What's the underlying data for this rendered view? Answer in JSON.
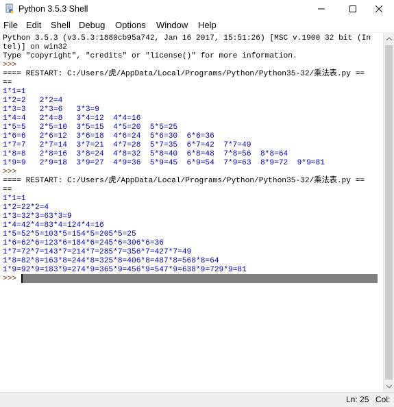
{
  "window": {
    "title": "Python 3.5.3 Shell"
  },
  "menu": {
    "items": [
      "File",
      "Edit",
      "Shell",
      "Debug",
      "Options",
      "Window",
      "Help"
    ]
  },
  "shell": {
    "lines": [
      {
        "text": "Python 3.5.3 (v3.5.3:1880cb95a742, Jan 16 2017, 15:51:26) [MSC v.1900 32 bit (In",
        "style": "black"
      },
      {
        "text": "tel)] on win32",
        "style": "black"
      },
      {
        "text": "Type \"copyright\", \"credits\" or \"license()\" for more information.",
        "style": "black"
      },
      {
        "text": ">>> ",
        "style": "prompt"
      },
      {
        "text": "==== RESTART: C:/Users/虎/AppData/Local/Programs/Python/Python35-32/乘法表.py ==",
        "style": "black"
      },
      {
        "text": "==",
        "style": "black"
      },
      {
        "text": "1*1=1",
        "style": "blue"
      },
      {
        "text": "1*2=2   2*2=4",
        "style": "blue"
      },
      {
        "text": "1*3=3   2*3=6   3*3=9",
        "style": "blue"
      },
      {
        "text": "1*4=4   2*4=8   3*4=12  4*4=16",
        "style": "blue"
      },
      {
        "text": "1*5=5   2*5=10  3*5=15  4*5=20  5*5=25",
        "style": "blue"
      },
      {
        "text": "1*6=6   2*6=12  3*6=18  4*6=24  5*6=30  6*6=36",
        "style": "blue"
      },
      {
        "text": "1*7=7   2*7=14  3*7=21  4*7=28  5*7=35  6*7=42  7*7=49",
        "style": "blue"
      },
      {
        "text": "1*8=8   2*8=16  3*8=24  4*8=32  5*8=40  6*8=48  7*8=56  8*8=64",
        "style": "blue"
      },
      {
        "text": "1*9=9   2*9=18  3*9=27  4*9=36  5*9=45  6*9=54  7*9=63  8*9=72  9*9=81",
        "style": "blue"
      },
      {
        "text": ">>> ",
        "style": "prompt"
      },
      {
        "text": "==== RESTART: C:/Users/虎/AppData/Local/Programs/Python/Python35-32/乘法表.py ==",
        "style": "black"
      },
      {
        "text": "==",
        "style": "black"
      },
      {
        "text": "1*1=1",
        "style": "blue"
      },
      {
        "text": "1*2=22*2=4",
        "style": "blue"
      },
      {
        "text": "1*3=32*3=63*3=9",
        "style": "blue"
      },
      {
        "text": "1*4=42*4=83*4=124*4=16",
        "style": "blue"
      },
      {
        "text": "1*5=52*5=103*5=154*5=205*5=25",
        "style": "blue"
      },
      {
        "text": "1*6=62*6=123*6=184*6=245*6=306*6=36",
        "style": "blue"
      },
      {
        "text": "1*7=72*7=143*7=214*7=285*7=356*7=427*7=49",
        "style": "blue"
      },
      {
        "text": "1*8=82*8=163*8=244*8=325*8=406*8=487*8=568*8=64",
        "style": "blue"
      },
      {
        "text": "1*9=92*9=183*9=274*9=365*9=456*9=547*9=638*9=729*9=81",
        "style": "blue"
      },
      {
        "text": ">>> ",
        "style": "prompt"
      }
    ]
  },
  "statusbar": {
    "line": "Ln: 25",
    "col": "Col:"
  },
  "colors": {
    "output_blue": "#0000c0",
    "prompt_brown": "#8b2500",
    "selection_gray": "#808080"
  }
}
